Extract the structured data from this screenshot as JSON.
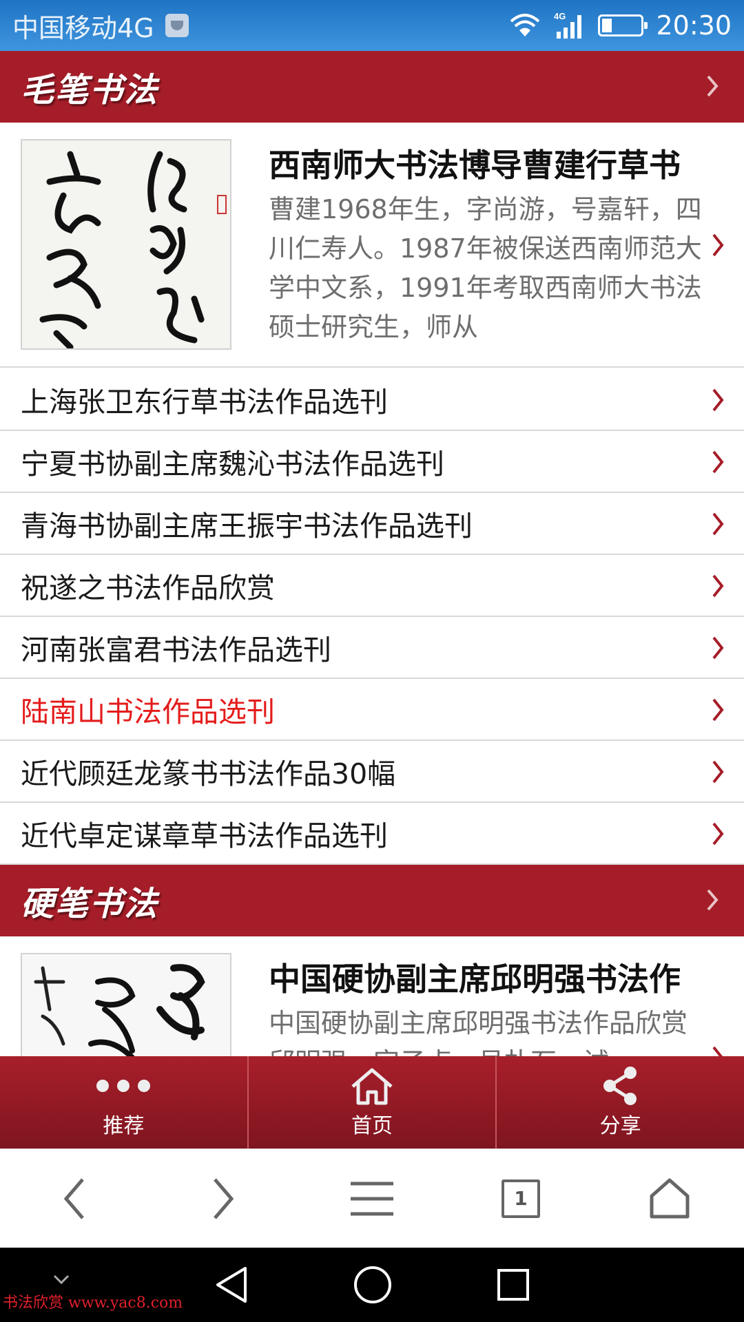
{
  "status_bar": {
    "carrier": "中国移动4G",
    "network_badge": "4G",
    "time": "20:30"
  },
  "sections": [
    {
      "title": "毛笔书法",
      "featured": {
        "headline": "西南师大书法博导曹建行草书",
        "summary": "曹建1968年生，字尚游，号嘉轩，四川仁寿人。1987年被保送西南师范大学中文系，1991年考取西南师大书法硕士研究生，师从"
      },
      "items": [
        "上海张卫东行草书法作品选刊",
        "宁夏书协副主席魏沁书法作品选刊",
        "青海书协副主席王振宇书法作品选刊",
        "祝遂之书法作品欣赏",
        "河南张富君书法作品选刊",
        "陆南山书法作品选刊",
        "近代顾廷龙篆书书法作品30幅",
        "近代卓定谋章草书法作品选刊"
      ],
      "highlighted_index": 5
    },
    {
      "title": "硬笔书法",
      "featured": {
        "headline": "中国硬协副主席邱明强书法作",
        "summary": "中国硬协副主席邱明强书法作品欣赏邱明强，字子贞，号朴石，试"
      }
    }
  ],
  "toolbar": {
    "recommend": "推荐",
    "home": "首页",
    "share": "分享"
  },
  "browser": {
    "tab_count": "1"
  },
  "watermark": "书法欣赏 www.yac8.com",
  "colors": {
    "brand_red": "#a51d28",
    "highlight_red": "#e41b1b",
    "status_blue": "#2a82d3"
  }
}
